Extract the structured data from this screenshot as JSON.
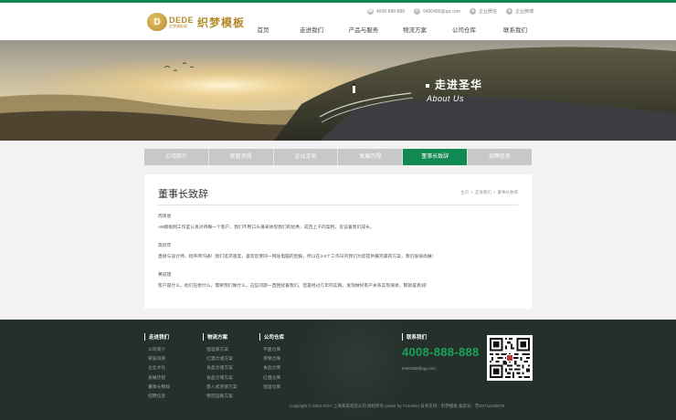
{
  "header": {
    "logo_badge": "D",
    "logo_en": "DEDE",
    "logo_sub": "织梦模板网",
    "logo_cn": "织梦模板",
    "phone": "4008-888-888",
    "email": "9490489@qq.com",
    "wechat": "企业微信",
    "weibo": "企业微博"
  },
  "nav": [
    "首页",
    "走进我们",
    "产品与服务",
    "物流方案",
    "公司仓库",
    "联系我们"
  ],
  "banner": {
    "title": "走进圣华",
    "subtitle": "About Us"
  },
  "tabs": [
    {
      "label": "公司简介",
      "active": false
    },
    {
      "label": "荣誉资质",
      "active": false
    },
    {
      "label": "企业文化",
      "active": false
    },
    {
      "label": "发展历程",
      "active": false
    },
    {
      "label": "董事长致辞",
      "active": true
    },
    {
      "label": "招聘信息",
      "active": false
    }
  ],
  "content": {
    "title": "董事长致辞",
    "breadcrumb": [
      "主页",
      "走进我们",
      "董事长致辞"
    ],
    "paragraphs": [
      {
        "name": "周贤星",
        "text": "AB模板网工作室认真对待每一个客户，我们不用口头语来体现我们的优秀，成百上千的案例，见证着我们成长。"
      },
      {
        "name": "高欣年",
        "text": "直接与设计师、程序师沟通！我们追求速度，喜欢您受同一网站电脑的回报，所以在3-5个工作日内我们为您提供最完美的方案，我们很很尚展！"
      },
      {
        "name": "黄成璞",
        "text": "客户是什么，他们在想什么，需要我们做什么，这些问题一直困扰着我们。但是经过几年的实践，发现做好客户关系实现很易，那就是真诚！"
      }
    ]
  },
  "footer": {
    "columns": [
      {
        "title": "走进我们",
        "items": [
          "公司简介",
          "荣誉资质",
          "企业文化",
          "发展历程",
          "董事长致辞",
          "招聘信息"
        ]
      },
      {
        "title": "物流方案",
        "items": [
          "恒温库方案",
          "红酒仓储方案",
          "食品仓储方案",
          "食品仓储方案",
          "量入式货架方案",
          "物流运输方案"
        ]
      },
      {
        "title": "公司仓库",
        "items": [
          "平面仓库",
          "货架仓库",
          "食品仓库",
          "红酒仓库",
          "恒温仓库"
        ]
      }
    ],
    "contact_title": "联系我们",
    "phone": "4008-888-888",
    "email": "9490489@qq.com",
    "copyright": "Copyright © 2002-2017 上海某某商贸公司 版权所有 power by YzJoRen  技术支持：织梦模板   备案号：苏ICP12345678"
  },
  "colors": {
    "accent": "#108a52",
    "footer_bg": "#25302b",
    "tab_bg": "#c8c8c8"
  }
}
